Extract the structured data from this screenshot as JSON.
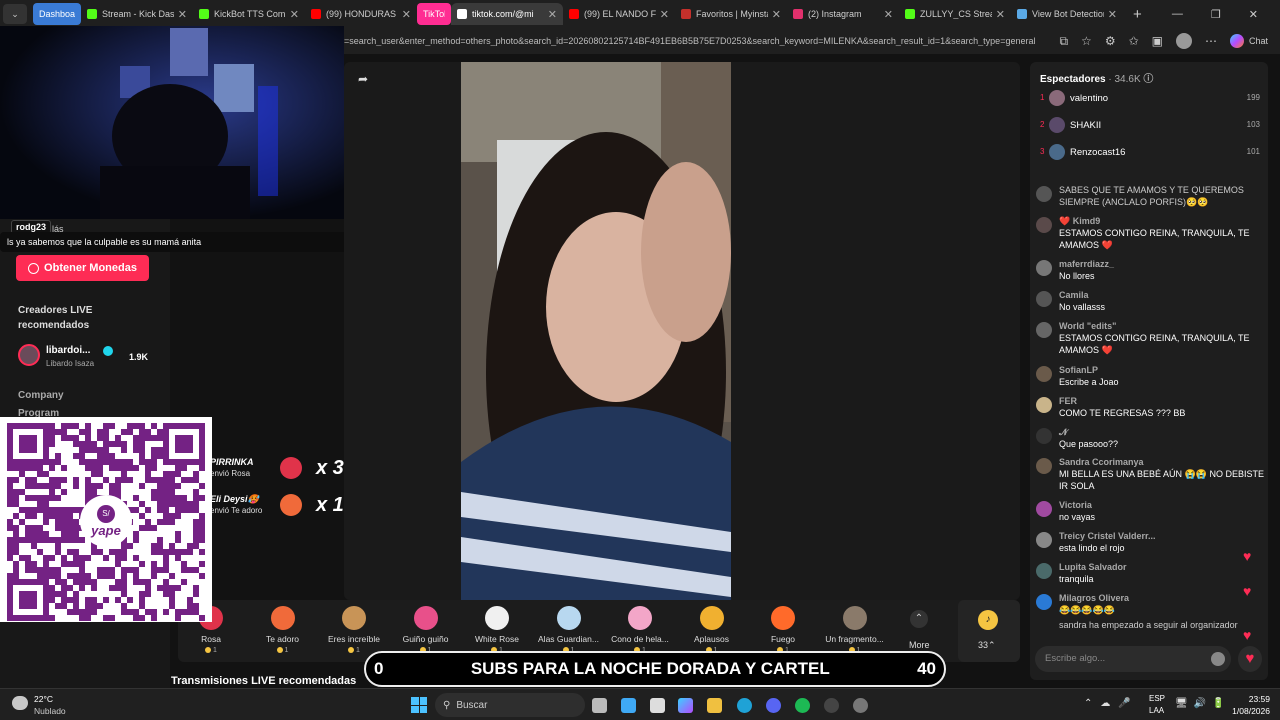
{
  "tabs": [
    {
      "label": "Dashboard",
      "color": "#3a7bd5",
      "active": false
    },
    {
      "label": "Stream - Kick Dashb",
      "color": "#53fc18"
    },
    {
      "label": "KickBot TTS Comma",
      "color": "#53fc18"
    },
    {
      "label": "(99) HONDURAS VS",
      "color": "#ff0000"
    },
    {
      "label": "TikTok",
      "color": "#ff2d92"
    },
    {
      "label": "tiktok.com/@mi",
      "color": "#fff"
    },
    {
      "label": "(99) EL NANDO FEST",
      "color": "#ff0000"
    },
    {
      "label": "Favoritos | Myinstant",
      "color": "#c4302b"
    },
    {
      "label": "(2) Instagram",
      "color": "#e1306c"
    },
    {
      "label": "ZULLYY_CS Stream -",
      "color": "#53fc18"
    },
    {
      "label": "View Bot Detection &",
      "color": "#5aa9e6"
    }
  ],
  "address": {
    "url": "=search_user&enter_method=others_photo&search_id=20260802125714BF491EB6B5B75E7D0253&search_keyword=MILENKA&search_result_id=1&search_type=general",
    "chat_label": "Chat"
  },
  "overlay": {
    "cam_user": "rodg23",
    "cam_extra": "lás",
    "cam_msg": "ls ya sabemos que la culpable es su mamá anita"
  },
  "sidebar": {
    "coins_btn": "Obtener Monedas",
    "section": "Creadores LIVE recomendados",
    "creator_name": "libardoi...",
    "creator_sub": "Libardo Isaza",
    "creator_count": "1.9K",
    "links": [
      "Company",
      "Program"
    ]
  },
  "gift_notices": [
    {
      "user": "PIRRINKA",
      "action": "envió Rosa",
      "mult": "x 3",
      "color": "#e0334a"
    },
    {
      "user": "Eli Deysi🥵",
      "action": "envió Te adoro",
      "mult": "x 1",
      "color": "#f06a3a"
    }
  ],
  "gifts": [
    {
      "name": "Rosa",
      "price": "1",
      "color": "#e0334a"
    },
    {
      "name": "Te adoro",
      "price": "1",
      "color": "#f06a3a"
    },
    {
      "name": "Eres increíble",
      "price": "1",
      "color": "#c89457"
    },
    {
      "name": "Guiño guiño",
      "price": "1",
      "color": "#e8508a"
    },
    {
      "name": "White Rose",
      "price": "1",
      "color": "#f0f0f0"
    },
    {
      "name": "Alas Guardian...",
      "price": "1",
      "color": "#b8d8f0"
    },
    {
      "name": "Cono de hela...",
      "price": "1",
      "color": "#f3a6c8"
    },
    {
      "name": "Aplausos",
      "price": "1",
      "color": "#f0b030"
    },
    {
      "name": "Fuego",
      "price": "1",
      "color": "#ff6a2a"
    },
    {
      "name": "Un fragmento...",
      "price": "1",
      "color": "#8a7a6a"
    }
  ],
  "gift_more": "More",
  "coins_count": "33",
  "banner": {
    "left": "0",
    "text": "SUBS PARA LA NOCHE DORADA Y CARTEL",
    "right": "40"
  },
  "below": "Transmisiones LIVE recomendadas",
  "chat": {
    "viewers_label": "Espectadores",
    "viewers": "34.6K",
    "top": [
      {
        "rank": "1",
        "name": "valentino",
        "score": "199"
      },
      {
        "rank": "2",
        "name": "SHAKII",
        "score": "103"
      },
      {
        "rank": "3",
        "name": "Renzocast16",
        "score": "101"
      }
    ],
    "messages": [
      {
        "user": "",
        "text": "SABES QUE TE AMAMOS Y TE QUEREMOS SIEMPRE (ANCLALO PORFIS)🥺🥺"
      },
      {
        "user": "❤️ Kimd9",
        "text": "ESTAMOS CONTIGO REINA, TRANQUILA, TE AMAMOS ❤️"
      },
      {
        "user": "maferrdiazz_",
        "text": "No llores"
      },
      {
        "user": "Camila",
        "text": "No vallasss"
      },
      {
        "user": "World \"edits\"",
        "text": "ESTAMOS CONTIGO REINA, TRANQUILA, TE AMAMOS ❤️"
      },
      {
        "user": "SofianLP",
        "text": "Escribe a Joao"
      },
      {
        "user": "FER",
        "text": "COMO TE REGRESAS ??? BB"
      },
      {
        "user": "𝓝",
        "text": "Que pasooo??"
      },
      {
        "user": "Sandra Ccorimanya",
        "text": "MI BELLA ES UNA BEBÉ AÚN 😭😭 NO DEBISTE IR SOLA"
      },
      {
        "user": "Victoria",
        "text": "no vayas"
      },
      {
        "user": "Treicy Cristel Valderr...",
        "text": "esta lindo el rojo"
      },
      {
        "user": "Lupita Salvador",
        "text": "tranquila"
      },
      {
        "user": "Milagros Olivera",
        "text": "😂😂😂😂😂"
      },
      {
        "user": "sandra",
        "text": "ha empezado a seguir al organizador"
      }
    ],
    "input_placeholder": "Escribe algo..."
  },
  "taskbar": {
    "weather_temp": "22°C",
    "weather_desc": "Nublado",
    "search": "Buscar",
    "lang": "ESP",
    "lang2": "LAA",
    "time": "23:59",
    "date": "1/08/2026"
  },
  "qr_brand": "yape"
}
